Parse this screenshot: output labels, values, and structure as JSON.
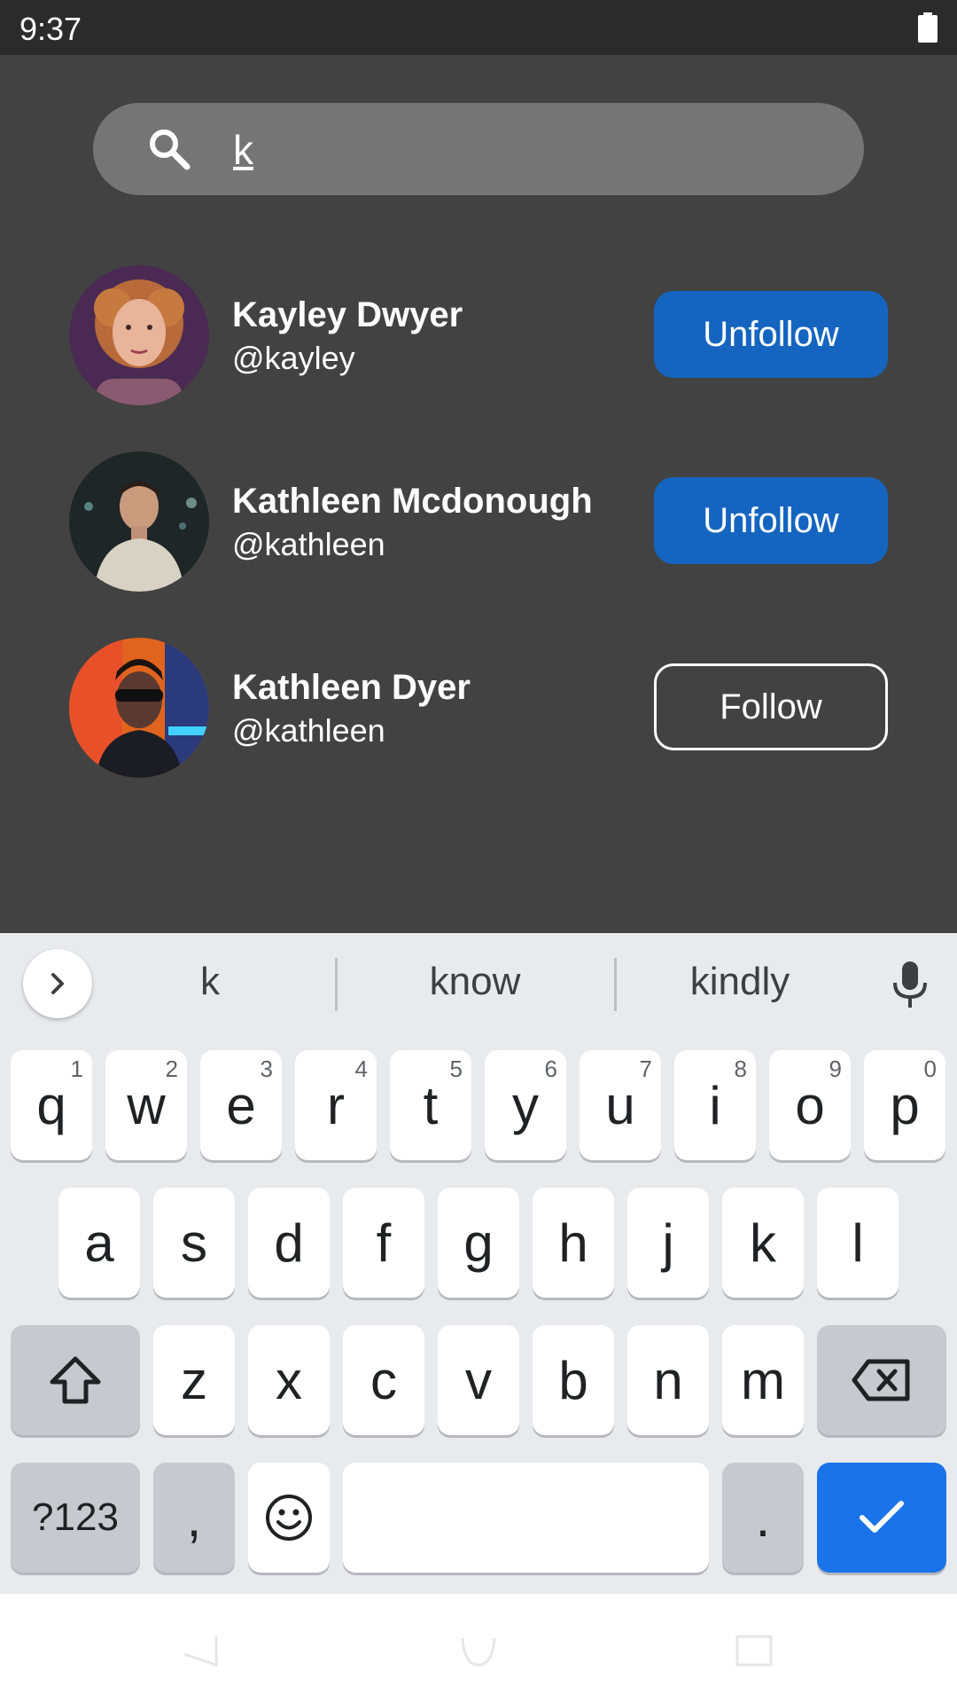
{
  "status_bar": {
    "time": "9:37"
  },
  "search": {
    "value": "k"
  },
  "users": [
    {
      "name": "Kayley Dwyer",
      "handle": "@kayley",
      "button": "Unfollow"
    },
    {
      "name": "Kathleen Mcdonough",
      "handle": "@kathleen",
      "button": "Unfollow"
    },
    {
      "name": "Kathleen Dyer",
      "handle": "@kathleen",
      "button": "Follow"
    }
  ],
  "colors": {
    "background": "#424242",
    "button_blue": "#1565c0",
    "enter_blue": "#1a73e8"
  },
  "keyboard": {
    "suggestions": [
      "k",
      "know",
      "kindly"
    ],
    "row1": [
      {
        "key": "q",
        "num": "1"
      },
      {
        "key": "w",
        "num": "2"
      },
      {
        "key": "e",
        "num": "3"
      },
      {
        "key": "r",
        "num": "4"
      },
      {
        "key": "t",
        "num": "5"
      },
      {
        "key": "y",
        "num": "6"
      },
      {
        "key": "u",
        "num": "7"
      },
      {
        "key": "i",
        "num": "8"
      },
      {
        "key": "o",
        "num": "9"
      },
      {
        "key": "p",
        "num": "0"
      }
    ],
    "row2": [
      "a",
      "s",
      "d",
      "f",
      "g",
      "h",
      "j",
      "k",
      "l"
    ],
    "row3": [
      "z",
      "x",
      "c",
      "v",
      "b",
      "n",
      "m"
    ],
    "symbols_label": "?123",
    "comma": ",",
    "period": "."
  }
}
